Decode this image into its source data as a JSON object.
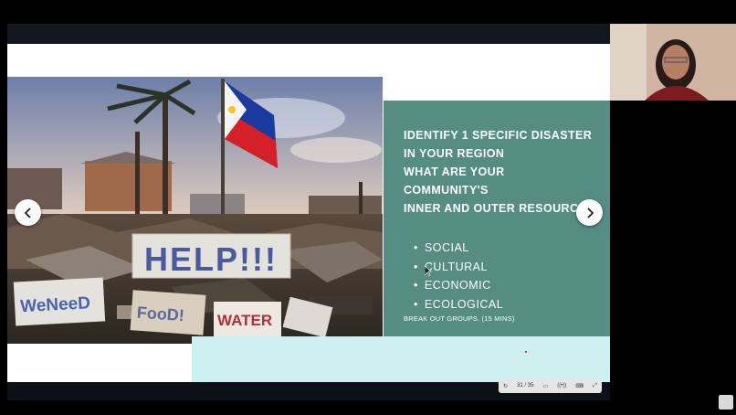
{
  "slide": {
    "heading_lines": [
      "IDENTIFY 1 SPECIFIC DISASTER",
      "IN YOUR REGION",
      "WHAT ARE YOUR",
      "COMMUNITY'S",
      "INNER AND OUTER RESOURCES?"
    ],
    "bullets": [
      "SOCIAL",
      "CULTURAL",
      "ECONOMIC",
      "ECOLOGICAL"
    ],
    "note": "BREAK OUT GROUPS. (15 MINS)",
    "photo_signs": {
      "help": "HELP!!!",
      "we_need": "WeNeeD",
      "food": "FooD!",
      "water": "WATER"
    },
    "colors": {
      "panel": "#568d83",
      "panel_bottom": "#cdf1f1"
    }
  },
  "navigation": {
    "prev_icon": "chevron-left-icon",
    "next_icon": "chevron-right-icon"
  },
  "controls": {
    "page_indicator": "31 / 35"
  }
}
